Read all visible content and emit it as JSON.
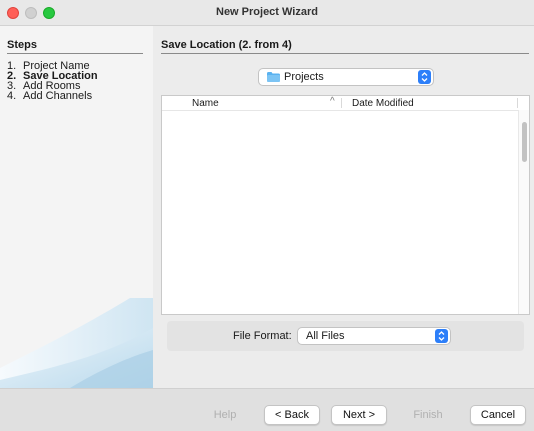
{
  "window": {
    "title": "New Project Wizard"
  },
  "sidebar": {
    "title": "Steps",
    "steps": [
      {
        "num": "1.",
        "label": "Project Name",
        "active": false
      },
      {
        "num": "2.",
        "label": "Save Location",
        "active": true
      },
      {
        "num": "3.",
        "label": "Add Rooms",
        "active": false
      },
      {
        "num": "4.",
        "label": "Add Channels",
        "active": false
      }
    ]
  },
  "main": {
    "title": "Save Location (2. from 4)",
    "folder_select": {
      "value": "Projects",
      "icon": "folder-icon"
    },
    "file_list": {
      "columns": {
        "name": "Name",
        "date": "Date Modified"
      },
      "sort_indicator": "^",
      "rows": []
    },
    "file_format": {
      "label": "File Format:",
      "value": "All Files"
    }
  },
  "buttons": {
    "help": "Help",
    "back": "< Back",
    "next": "Next >",
    "finish": "Finish",
    "cancel": "Cancel"
  },
  "colors": {
    "accent": "#2d7ff9",
    "close": "#ff5f57",
    "zoom": "#28c840",
    "folder": "#5ab2f0"
  }
}
